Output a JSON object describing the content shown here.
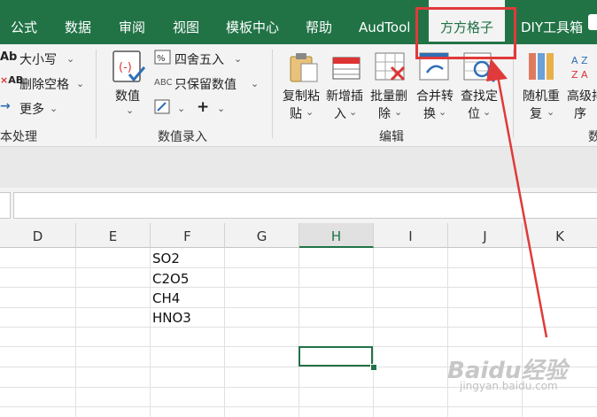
{
  "tabs": [
    {
      "label": "公式"
    },
    {
      "label": "数据"
    },
    {
      "label": "审阅"
    },
    {
      "label": "视图"
    },
    {
      "label": "模板中心"
    },
    {
      "label": "帮助"
    },
    {
      "label": "AudTool"
    },
    {
      "label": "方方格子",
      "active": true
    },
    {
      "label": "DIY工具箱"
    }
  ],
  "ribbon": {
    "text_group": {
      "case_label": "大小写",
      "delete_space_label": "删除空格",
      "more_label": "更多",
      "group_label": "本处理"
    },
    "numeric_group": {
      "value_label": "数值",
      "round_label": "四舍五入",
      "keep_value_label": "只保留数值",
      "group_label": "数值录入"
    },
    "edit_group": {
      "copy_paste_l1": "复制粘",
      "copy_paste_l2": "贴",
      "insert_l1": "新增插",
      "insert_l2": "入",
      "batch_delete_l1": "批量删",
      "batch_delete_l2": "除",
      "merge_l1": "合并转",
      "merge_l2": "换",
      "find_l1": "查找定",
      "find_l2": "位",
      "group_label": "编辑"
    },
    "data_group": {
      "random_l1": "随机重",
      "random_l2": "复",
      "sort_l1": "高级排",
      "sort_l2": "序",
      "group_label": "数"
    }
  },
  "grid": {
    "columns": [
      "D",
      "E",
      "F",
      "G",
      "H",
      "I",
      "J",
      "K"
    ],
    "selected_column": "H",
    "cells": {
      "F1": "SO2",
      "F2": "C2O5",
      "F3": "CH4",
      "F4": "HNO3"
    }
  },
  "watermark": {
    "text": "Baidu经验",
    "subtext": "jingyan.baidu.com"
  },
  "colors": {
    "accent": "#217346",
    "highlight": "#e03a3a"
  }
}
